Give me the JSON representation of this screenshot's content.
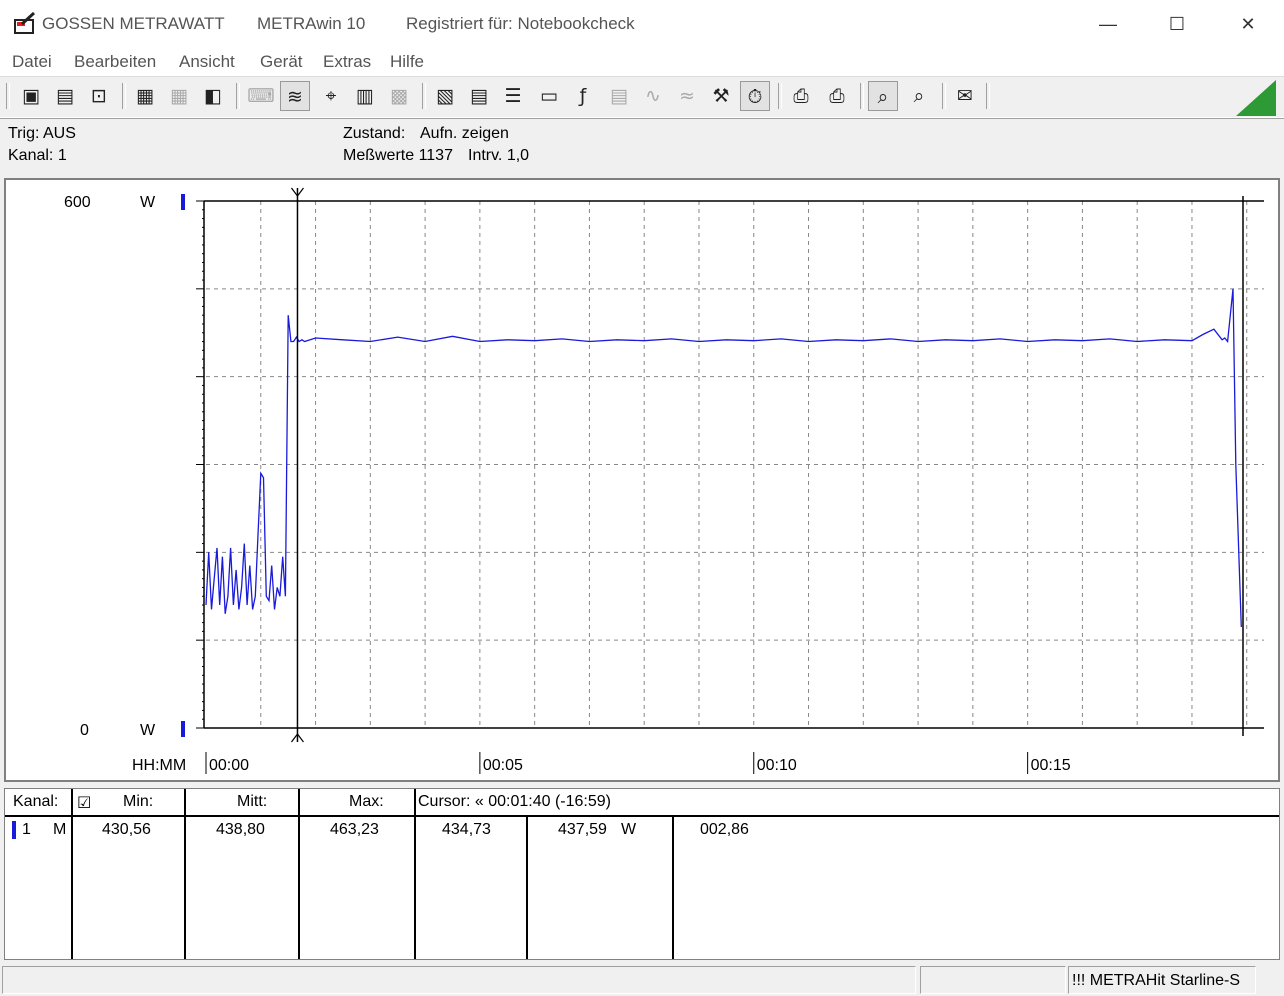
{
  "window": {
    "app_name": "GOSSEN METRAWATT",
    "product": "METRAwin 10",
    "registered": "Registriert für: Notebookcheck",
    "minimize": "—",
    "maximize": "☐",
    "close": "✕"
  },
  "menu": [
    "Datei",
    "Bearbeiten",
    "Ansicht",
    "Gerät",
    "Extras",
    "Hilfe"
  ],
  "toolbar_icons": [
    "save-icon",
    "save-as-icon",
    "open-icon",
    "device-icon",
    "device-disabled-icon",
    "device-read-icon",
    "keyboard-icon",
    "waveform-icon",
    "crosshair-icon",
    "table-icon",
    "grid-icon",
    "settings-icon",
    "data-icon",
    "list-icon",
    "monitor-icon",
    "function-icon",
    "memory-icon",
    "signal-icon",
    "noise-icon",
    "tools-icon",
    "timer-icon",
    "printer-icon",
    "print-icon",
    "zoom-icon",
    "zoom-out-icon",
    "help-message-icon"
  ],
  "info": {
    "trig": "Trig: AUS",
    "kanal": "Kanal: 1",
    "zustand_label": "Zustand:",
    "zustand_value": "Aufn. zeigen",
    "messwerte": "Meßwerte 1137",
    "intervall": "Intrv. 1,0"
  },
  "chart_data": {
    "type": "line",
    "y_top_label": "600",
    "y_bottom_label": "0",
    "y_unit": "W",
    "ylim": [
      0,
      600
    ],
    "x_axis_label": "HH:MM",
    "x_ticks": [
      "00:00",
      "00:05",
      "00:10",
      "00:15"
    ],
    "x_tick_minutes": [
      0,
      5,
      10,
      15
    ],
    "xlim_minutes": [
      0,
      18.95
    ],
    "cursor_minutes": 1.67,
    "grid": true,
    "line_color": "#1a1adb",
    "series": [
      {
        "x": [
          0,
          0.05,
          0.1,
          0.15,
          0.2,
          0.25,
          0.3,
          0.35,
          0.4,
          0.45,
          0.5,
          0.55,
          0.6,
          0.65,
          0.7,
          0.75,
          0.8,
          0.85,
          0.9,
          0.95,
          1.0,
          1.05,
          1.1,
          1.15,
          1.2,
          1.25,
          1.3,
          1.35,
          1.4,
          1.45,
          1.5,
          1.55,
          1.6,
          1.65,
          1.7,
          1.75,
          1.8,
          2.0,
          2.5,
          3.0,
          3.5,
          4.0,
          4.5,
          5.0,
          5.5,
          6.0,
          6.5,
          7.0,
          7.5,
          8.0,
          8.5,
          9.0,
          9.5,
          10.0,
          10.5,
          11.0,
          11.5,
          12.0,
          12.5,
          13.0,
          13.5,
          14.0,
          14.5,
          15.0,
          15.5,
          16.0,
          16.5,
          17.0,
          17.5,
          18.0,
          18.2,
          18.4,
          18.5,
          18.55,
          18.6,
          18.65,
          18.7,
          18.75,
          18.8,
          18.9
        ],
        "y": [
          140,
          200,
          135,
          170,
          205,
          140,
          195,
          130,
          150,
          205,
          140,
          180,
          135,
          160,
          210,
          140,
          185,
          135,
          150,
          220,
          290,
          285,
          150,
          145,
          185,
          135,
          160,
          150,
          195,
          150,
          470,
          440,
          440,
          445,
          440,
          442,
          440,
          444,
          442,
          440,
          445,
          440,
          446,
          440,
          442,
          441,
          443,
          440,
          442,
          441,
          443,
          440,
          442,
          441,
          443,
          440,
          442,
          441,
          443,
          440,
          442,
          441,
          443,
          440,
          442,
          441,
          443,
          440,
          442,
          441,
          448,
          454,
          446,
          442,
          444,
          440,
          470,
          500,
          300,
          115
        ]
      }
    ]
  },
  "table": {
    "headers": {
      "kanal": "Kanal:",
      "check": "☑",
      "min": "Min:",
      "mitt": "Mitt:",
      "max": "Max:",
      "cursor": "Cursor: « 00:01:40 (-16:59)"
    },
    "row": {
      "channel": "1",
      "mode": "M",
      "min": "430,56",
      "mitt": "438,80",
      "max": "463,23",
      "cursor1": "434,73",
      "cursor2": "437,59",
      "unit": "W",
      "diff": "002,86"
    }
  },
  "status": {
    "device": "!!! METRAHit Starline-S"
  }
}
